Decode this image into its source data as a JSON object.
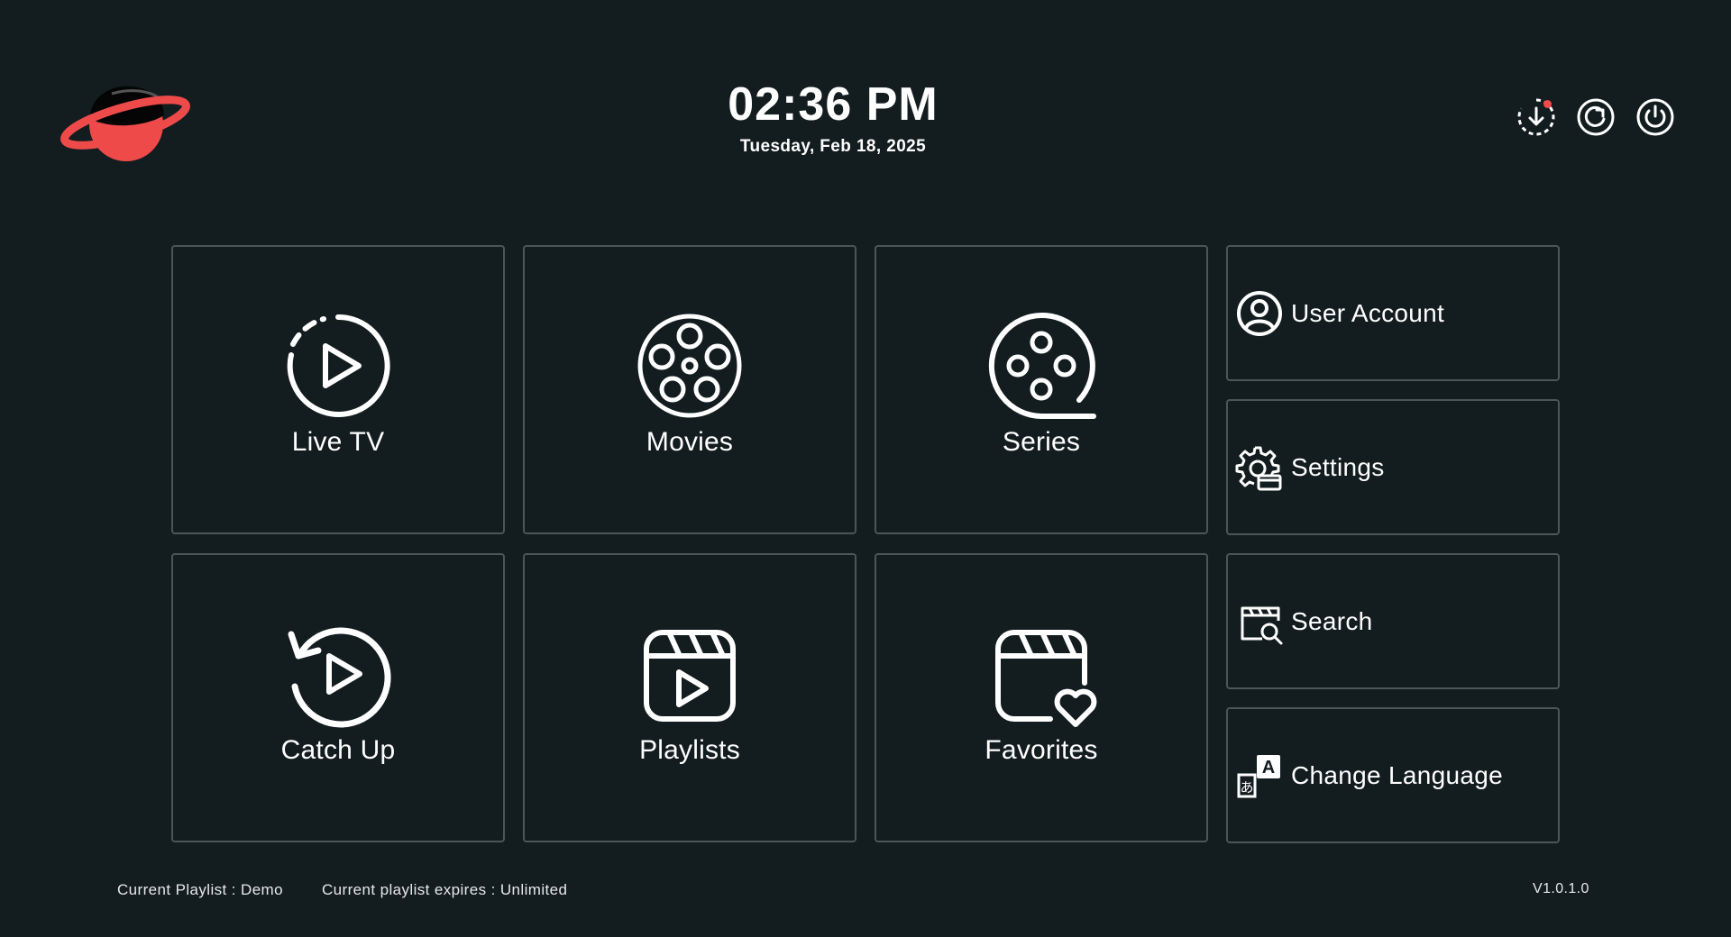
{
  "header": {
    "time": "02:36 PM",
    "date": "Tuesday, Feb 18, 2025"
  },
  "top_icons": [
    "download-icon",
    "refresh-icon",
    "power-icon"
  ],
  "tiles": [
    {
      "label": "Live TV",
      "icon": "live-tv-icon"
    },
    {
      "label": "Movies",
      "icon": "film-reel-icon"
    },
    {
      "label": "Series",
      "icon": "series-reel-icon"
    },
    {
      "label": "Catch Up",
      "icon": "catch-up-icon"
    },
    {
      "label": "Playlists",
      "icon": "playlist-icon"
    },
    {
      "label": "Favorites",
      "icon": "favorites-icon"
    }
  ],
  "side_menu": [
    {
      "label": "User Account",
      "icon": "user-account-icon"
    },
    {
      "label": "Settings",
      "icon": "settings-icon"
    },
    {
      "label": "Search",
      "icon": "search-icon"
    },
    {
      "label": "Change Language",
      "icon": "language-icon"
    }
  ],
  "footer": {
    "playlist": "Current Playlist : Demo",
    "expires": "Current playlist expires : Unlimited",
    "version": "V1.0.1.0"
  },
  "colors": {
    "background": "#131c1f",
    "tile_border": "#4c5558",
    "logo_red": "#ef4a4a",
    "notification": "#f04a4a"
  }
}
